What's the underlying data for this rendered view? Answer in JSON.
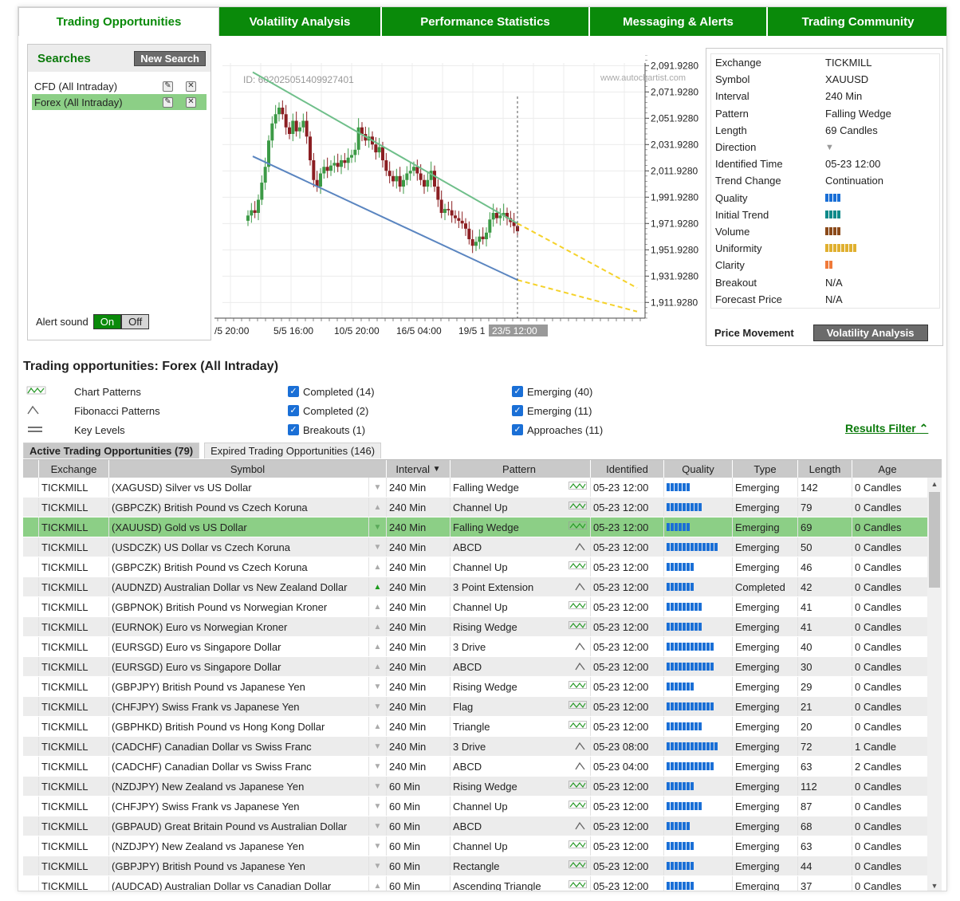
{
  "tabs": [
    {
      "label": "Trading Opportunities",
      "active": true
    },
    {
      "label": "Volatility Analysis",
      "active": false
    },
    {
      "label": "Performance Statistics",
      "active": false
    },
    {
      "label": "Messaging & Alerts",
      "active": false
    },
    {
      "label": "Trading Community",
      "active": false
    }
  ],
  "searches": {
    "title": "Searches",
    "new_button": "New Search",
    "items": [
      {
        "label": "CFD (All Intraday)",
        "selected": false
      },
      {
        "label": "Forex (All Intraday)",
        "selected": true
      }
    ],
    "alert_sound_label": "Alert sound",
    "on_label": "On",
    "off_label": "Off"
  },
  "chart": {
    "id_label": "ID: 602025051409927401",
    "watermark": "www.autochartist.com",
    "y_ticks": [
      "2,091.9280",
      "2,071.9280",
      "2,051.9280",
      "2,031.9280",
      "2,011.9280",
      "1,991.9280",
      "1,971.9280",
      "1,951.9280",
      "1,931.9280",
      "1,911.9280"
    ],
    "x_ticks": [
      "/5 20:00",
      "5/5 16:00",
      "10/5 20:00",
      "16/5 04:00",
      "19/5 1"
    ],
    "x_highlight": "23/5 12:00"
  },
  "chart_data": {
    "type": "candlestick",
    "ylim": [
      1900,
      2100
    ],
    "y_ticks": [
      2091.928,
      2071.928,
      2051.928,
      2031.928,
      2011.928,
      1991.928,
      1971.928,
      1951.928,
      1931.928,
      1911.928
    ],
    "x_ticks": [
      "/5 20:00",
      "5/5 16:00",
      "10/5 20:00",
      "16/5 04:00",
      "19/5 1",
      "23/5 12:00"
    ],
    "upper_trend_line": [
      2087,
      1972
    ],
    "lower_trend_line": [
      2023,
      1929
    ],
    "forecast_upper_end": 1923,
    "forecast_lower_end": 1905,
    "closes": [
      1978,
      1982,
      1980,
      1990,
      2003,
      2015,
      2035,
      2048,
      2055,
      2060,
      2055,
      2045,
      2040,
      2050,
      2042,
      2045,
      2050,
      2038,
      2020,
      2005,
      2000,
      2010,
      2015,
      2012,
      2016,
      2018,
      2015,
      2020,
      2018,
      2022,
      2024,
      2028,
      2045,
      2040,
      2035,
      2038,
      2032,
      2026,
      2030,
      2020,
      2012,
      2008,
      2004,
      2008,
      2000,
      2005,
      2010,
      2012,
      2015,
      2010,
      2005,
      2000,
      2005,
      2012,
      2000,
      1990,
      1980,
      1983,
      1982,
      1978,
      1976,
      1974,
      1972,
      1968,
      1960,
      1955,
      1958,
      1962,
      1960,
      1965,
      1975,
      1980,
      1976,
      1978,
      1980,
      1976,
      1973,
      1970,
      1966
    ]
  },
  "details": {
    "rows": [
      {
        "key": "Exchange",
        "value": "TICKMILL"
      },
      {
        "key": "Symbol",
        "value": "XAUUSD"
      },
      {
        "key": "Interval",
        "value": "240 Min"
      },
      {
        "key": "Pattern",
        "value": "Falling Wedge"
      },
      {
        "key": "Length",
        "value": "69 Candles"
      },
      {
        "key": "Direction",
        "value": "▼"
      },
      {
        "key": "Identified Time",
        "value": "05-23 12:00"
      },
      {
        "key": "Trend Change",
        "value": "Continuation"
      },
      {
        "key": "Quality",
        "value": ""
      },
      {
        "key": "Initial Trend",
        "value": ""
      },
      {
        "key": "Volume",
        "value": ""
      },
      {
        "key": "Uniformity",
        "value": ""
      },
      {
        "key": "Clarity",
        "value": ""
      },
      {
        "key": "Breakout",
        "value": "N/A"
      },
      {
        "key": "Forecast Price",
        "value": "N/A"
      }
    ],
    "indicators": {
      "quality": {
        "level": 4,
        "color": "#1a6fd6"
      },
      "initial_trend": {
        "level": 4,
        "color": "#0e8a8a"
      },
      "volume": {
        "level": 4,
        "color": "#8b4a1a"
      },
      "uniformity": {
        "level": 8,
        "color": "#e0b030"
      },
      "clarity": {
        "level": 2,
        "color": "#f07a3a"
      }
    },
    "price_movement_label": "Price Movement",
    "volatility_button": "Volatility Analysis"
  },
  "section_title": "Trading opportunities: Forex (All Intraday)",
  "pattern_types": [
    {
      "icon": "chart-pattern-icon",
      "label": "Chart Patterns"
    },
    {
      "icon": "fibonacci-icon",
      "label": "Fibonacci Patterns"
    },
    {
      "icon": "key-levels-icon",
      "label": "Key Levels"
    }
  ],
  "filters_completed": [
    {
      "label": "Completed (14)",
      "checked": true
    },
    {
      "label": "Completed (2)",
      "checked": true
    },
    {
      "label": "Breakouts (1)",
      "checked": true
    }
  ],
  "filters_emerging": [
    {
      "label": "Emerging (40)",
      "checked": true
    },
    {
      "label": "Emerging (11)",
      "checked": true
    },
    {
      "label": "Approaches (11)",
      "checked": true
    }
  ],
  "results_filter": "Results Filter",
  "subtabs": [
    {
      "label": "Active Trading Opportunities (79)",
      "active": true
    },
    {
      "label": "Expired Trading Opportunities (146)",
      "active": false
    }
  ],
  "table": {
    "columns": [
      "Exchange",
      "Symbol",
      "Interval",
      "Pattern",
      "Identified",
      "Quality",
      "Type",
      "Length",
      "Age"
    ],
    "rows": [
      {
        "exchange": "TICKMILL",
        "symbol": "(XAGUSD) Silver vs US Dollar",
        "dir": "down",
        "interval": "240 Min",
        "pattern": "Falling Wedge",
        "kind": "chart",
        "identified": "05-23 12:00",
        "quality": 6,
        "type": "Emerging",
        "length": "142",
        "age": "0 Candles"
      },
      {
        "exchange": "TICKMILL",
        "symbol": "(GBPCZK) British Pound vs Czech Koruna",
        "dir": "up",
        "interval": "240 Min",
        "pattern": "Channel Up",
        "kind": "chart",
        "identified": "05-23 12:00",
        "quality": 9,
        "type": "Emerging",
        "length": "79",
        "age": "0 Candles"
      },
      {
        "exchange": "TICKMILL",
        "symbol": "(XAUUSD) Gold vs US Dollar",
        "dir": "down",
        "interval": "240 Min",
        "pattern": "Falling Wedge",
        "kind": "chart",
        "identified": "05-23 12:00",
        "quality": 6,
        "type": "Emerging",
        "length": "69",
        "age": "0 Candles",
        "selected": true
      },
      {
        "exchange": "TICKMILL",
        "symbol": "(USDCZK) US Dollar vs Czech Koruna",
        "dir": "down",
        "interval": "240 Min",
        "pattern": "ABCD",
        "kind": "fib",
        "identified": "05-23 12:00",
        "quality": 13,
        "type": "Emerging",
        "length": "50",
        "age": "0 Candles"
      },
      {
        "exchange": "TICKMILL",
        "symbol": "(GBPCZK) British Pound vs Czech Koruna",
        "dir": "up",
        "interval": "240 Min",
        "pattern": "Channel Up",
        "kind": "chart",
        "identified": "05-23 12:00",
        "quality": 7,
        "type": "Emerging",
        "length": "46",
        "age": "0 Candles"
      },
      {
        "exchange": "TICKMILL",
        "symbol": "(AUDNZD) Australian Dollar vs New Zealand Dollar",
        "dir": "up-green",
        "interval": "240 Min",
        "pattern": "3 Point Extension",
        "kind": "fib",
        "identified": "05-23 12:00",
        "quality": 7,
        "type": "Completed",
        "length": "42",
        "age": "0 Candles"
      },
      {
        "exchange": "TICKMILL",
        "symbol": "(GBPNOK) British Pound vs Norwegian Kroner",
        "dir": "up",
        "interval": "240 Min",
        "pattern": "Channel Up",
        "kind": "chart",
        "identified": "05-23 12:00",
        "quality": 9,
        "type": "Emerging",
        "length": "41",
        "age": "0 Candles"
      },
      {
        "exchange": "TICKMILL",
        "symbol": "(EURNOK) Euro vs Norwegian Kroner",
        "dir": "up",
        "interval": "240 Min",
        "pattern": "Rising Wedge",
        "kind": "chart",
        "identified": "05-23 12:00",
        "quality": 9,
        "type": "Emerging",
        "length": "41",
        "age": "0 Candles"
      },
      {
        "exchange": "TICKMILL",
        "symbol": "(EURSGD) Euro vs Singapore Dollar",
        "dir": "up",
        "interval": "240 Min",
        "pattern": "3 Drive",
        "kind": "fib",
        "identified": "05-23 12:00",
        "quality": 12,
        "type": "Emerging",
        "length": "40",
        "age": "0 Candles"
      },
      {
        "exchange": "TICKMILL",
        "symbol": "(EURSGD) Euro vs Singapore Dollar",
        "dir": "up",
        "interval": "240 Min",
        "pattern": "ABCD",
        "kind": "fib",
        "identified": "05-23 12:00",
        "quality": 12,
        "type": "Emerging",
        "length": "30",
        "age": "0 Candles"
      },
      {
        "exchange": "TICKMILL",
        "symbol": "(GBPJPY) British Pound vs Japanese Yen",
        "dir": "down",
        "interval": "240 Min",
        "pattern": "Rising Wedge",
        "kind": "chart",
        "identified": "05-23 12:00",
        "quality": 7,
        "type": "Emerging",
        "length": "29",
        "age": "0 Candles"
      },
      {
        "exchange": "TICKMILL",
        "symbol": "(CHFJPY) Swiss Frank vs Japanese Yen",
        "dir": "down",
        "interval": "240 Min",
        "pattern": "Flag",
        "kind": "chart",
        "identified": "05-23 12:00",
        "quality": 12,
        "type": "Emerging",
        "length": "21",
        "age": "0 Candles"
      },
      {
        "exchange": "TICKMILL",
        "symbol": "(GBPHKD) British Pound vs Hong Kong Dollar",
        "dir": "up",
        "interval": "240 Min",
        "pattern": "Triangle",
        "kind": "chart",
        "identified": "05-23 12:00",
        "quality": 9,
        "type": "Emerging",
        "length": "20",
        "age": "0 Candles"
      },
      {
        "exchange": "TICKMILL",
        "symbol": "(CADCHF) Canadian Dollar vs Swiss Franc",
        "dir": "down",
        "interval": "240 Min",
        "pattern": "3 Drive",
        "kind": "fib",
        "identified": "05-23 08:00",
        "quality": 13,
        "type": "Emerging",
        "length": "72",
        "age": "1 Candle"
      },
      {
        "exchange": "TICKMILL",
        "symbol": "(CADCHF) Canadian Dollar vs Swiss Franc",
        "dir": "down",
        "interval": "240 Min",
        "pattern": "ABCD",
        "kind": "fib",
        "identified": "05-23 04:00",
        "quality": 12,
        "type": "Emerging",
        "length": "63",
        "age": "2 Candles"
      },
      {
        "exchange": "TICKMILL",
        "symbol": "(NZDJPY) New Zealand vs Japanese Yen",
        "dir": "down",
        "interval": "60 Min",
        "pattern": "Rising Wedge",
        "kind": "chart",
        "identified": "05-23 12:00",
        "quality": 7,
        "type": "Emerging",
        "length": "112",
        "age": "0 Candles"
      },
      {
        "exchange": "TICKMILL",
        "symbol": "(CHFJPY) Swiss Frank vs Japanese Yen",
        "dir": "down",
        "interval": "60 Min",
        "pattern": "Channel Up",
        "kind": "chart",
        "identified": "05-23 12:00",
        "quality": 9,
        "type": "Emerging",
        "length": "87",
        "age": "0 Candles"
      },
      {
        "exchange": "TICKMILL",
        "symbol": "(GBPAUD) Great Britain Pound vs Australian Dollar",
        "dir": "down",
        "interval": "60 Min",
        "pattern": "ABCD",
        "kind": "fib",
        "identified": "05-23 12:00",
        "quality": 6,
        "type": "Emerging",
        "length": "68",
        "age": "0 Candles"
      },
      {
        "exchange": "TICKMILL",
        "symbol": "(NZDJPY) New Zealand vs Japanese Yen",
        "dir": "down",
        "interval": "60 Min",
        "pattern": "Channel Up",
        "kind": "chart",
        "identified": "05-23 12:00",
        "quality": 7,
        "type": "Emerging",
        "length": "63",
        "age": "0 Candles"
      },
      {
        "exchange": "TICKMILL",
        "symbol": "(GBPJPY) British Pound vs Japanese Yen",
        "dir": "down",
        "interval": "60 Min",
        "pattern": "Rectangle",
        "kind": "chart",
        "identified": "05-23 12:00",
        "quality": 7,
        "type": "Emerging",
        "length": "44",
        "age": "0 Candles"
      },
      {
        "exchange": "TICKMILL",
        "symbol": "(AUDCAD) Australian Dollar vs Canadian Dollar",
        "dir": "up",
        "interval": "60 Min",
        "pattern": "Ascending Triangle",
        "kind": "chart",
        "identified": "05-23 12:00",
        "quality": 7,
        "type": "Emerging",
        "length": "37",
        "age": "0 Candles"
      }
    ]
  }
}
